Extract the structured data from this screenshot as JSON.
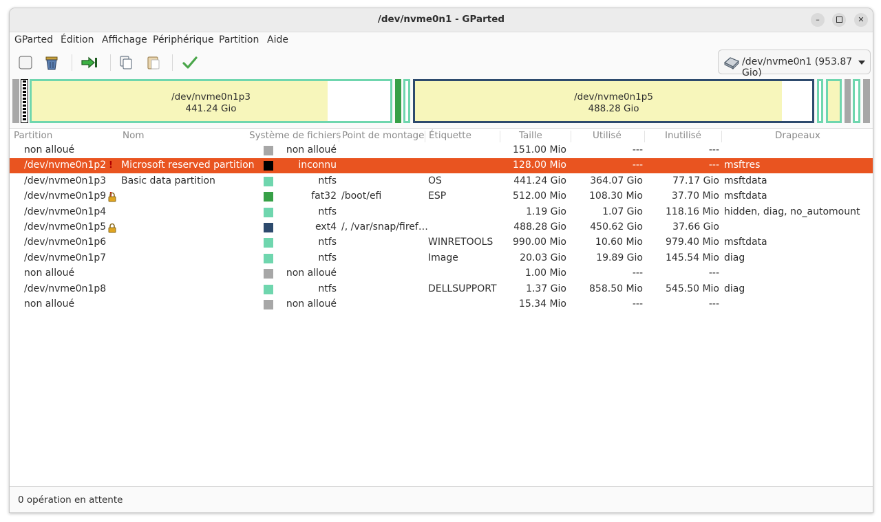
{
  "window": {
    "title": "/dev/nvme0n1 - GParted",
    "minimize_icon": "minimize-icon",
    "maximize_icon": "maximize-icon",
    "close_icon": "close-icon"
  },
  "menubar": {
    "items": [
      "GParted",
      "Édition",
      "Affichage",
      "Périphérique",
      "Partition",
      "Aide"
    ]
  },
  "toolbar": {
    "buttons": [
      {
        "icon": "new-partition-icon"
      },
      {
        "icon": "delete-partition-icon"
      },
      {
        "icon": "resize-move-icon"
      },
      {
        "icon": "copy-icon"
      },
      {
        "icon": "paste-icon"
      },
      {
        "icon": "apply-checkmark-icon"
      }
    ],
    "device_selector": {
      "icon": "hard-disk-icon",
      "label": "/dev/nvme0n1 (953.87 Gio)"
    }
  },
  "disk_map": {
    "p3": {
      "name": "/dev/nvme0n1p3",
      "size": "441.24 Gio",
      "used_fraction": 0.825
    },
    "p5": {
      "name": "/dev/nvme0n1p5",
      "size": "488.28 Gio",
      "used_fraction": 0.923
    }
  },
  "colors": {
    "ntfs": "#6fd6ae",
    "fat32": "#37a047",
    "ext4": "#2d4a6d",
    "unknown": "#000000",
    "unallocated": "#a7a7a7",
    "selection": "#e95420",
    "used_space": "#f7f6bb"
  },
  "table": {
    "columns": [
      "Partition",
      "Nom",
      "Système de fichiers",
      "Point de montage",
      "Étiquette",
      "Taille",
      "Utilisé",
      "Inutilisé",
      "Drapeaux"
    ],
    "rows": [
      {
        "partition": "non alloué",
        "name": "",
        "fs": "non alloué",
        "fs_color": "#a7a7a7",
        "mount": "",
        "label": "",
        "size": "151.00 Mio",
        "used": "---",
        "unused": "---",
        "flags": ""
      },
      {
        "partition": "/dev/nvme0n1p2",
        "name": "Microsoft reserved partition",
        "fs": "inconnu",
        "fs_color": "#000000",
        "mount": "",
        "label": "",
        "size": "128.00 Mio",
        "used": "---",
        "unused": "---",
        "flags": "msftres",
        "warn": true,
        "selected": true
      },
      {
        "partition": "/dev/nvme0n1p3",
        "name": "Basic data partition",
        "fs": "ntfs",
        "fs_color": "#6fd6ae",
        "mount": "",
        "label": "OS",
        "size": "441.24 Gio",
        "used": "364.07 Gio",
        "unused": "77.17 Gio",
        "flags": "msftdata"
      },
      {
        "partition": "/dev/nvme0n1p9",
        "name": "",
        "fs": "fat32",
        "fs_color": "#37a047",
        "mount": "/boot/efi",
        "label": "ESP",
        "size": "512.00 Mio",
        "used": "108.30 Mio",
        "unused": "37.70 Mio",
        "flags": "msftdata",
        "warn": true,
        "lock": true
      },
      {
        "partition": "/dev/nvme0n1p4",
        "name": "",
        "fs": "ntfs",
        "fs_color": "#6fd6ae",
        "mount": "",
        "label": "",
        "size": "1.19 Gio",
        "used": "1.07 Gio",
        "unused": "118.16 Mio",
        "flags": "hidden, diag, no_automount"
      },
      {
        "partition": "/dev/nvme0n1p5",
        "name": "",
        "fs": "ext4",
        "fs_color": "#2d4a6d",
        "mount": "/, /var/snap/firef…",
        "label": "",
        "size": "488.28 Gio",
        "used": "450.62 Gio",
        "unused": "37.66 Gio",
        "flags": "",
        "lock": true
      },
      {
        "partition": "/dev/nvme0n1p6",
        "name": "",
        "fs": "ntfs",
        "fs_color": "#6fd6ae",
        "mount": "",
        "label": "WINRETOOLS",
        "size": "990.00 Mio",
        "used": "10.60 Mio",
        "unused": "979.40 Mio",
        "flags": "msftdata"
      },
      {
        "partition": "/dev/nvme0n1p7",
        "name": "",
        "fs": "ntfs",
        "fs_color": "#6fd6ae",
        "mount": "",
        "label": "Image",
        "size": "20.03 Gio",
        "used": "19.89 Gio",
        "unused": "145.54 Mio",
        "flags": "diag"
      },
      {
        "partition": "non alloué",
        "name": "",
        "fs": "non alloué",
        "fs_color": "#a7a7a7",
        "mount": "",
        "label": "",
        "size": "1.00 Mio",
        "used": "---",
        "unused": "---",
        "flags": ""
      },
      {
        "partition": "/dev/nvme0n1p8",
        "name": "",
        "fs": "ntfs",
        "fs_color": "#6fd6ae",
        "mount": "",
        "label": "DELLSUPPORT",
        "size": "1.37 Gio",
        "used": "858.50 Mio",
        "unused": "545.50 Mio",
        "flags": "diag"
      },
      {
        "partition": "non alloué",
        "name": "",
        "fs": "non alloué",
        "fs_color": "#a7a7a7",
        "mount": "",
        "label": "",
        "size": "15.34 Mio",
        "used": "---",
        "unused": "---",
        "flags": ""
      }
    ]
  },
  "statusbar": {
    "text": "0 opération en attente"
  }
}
